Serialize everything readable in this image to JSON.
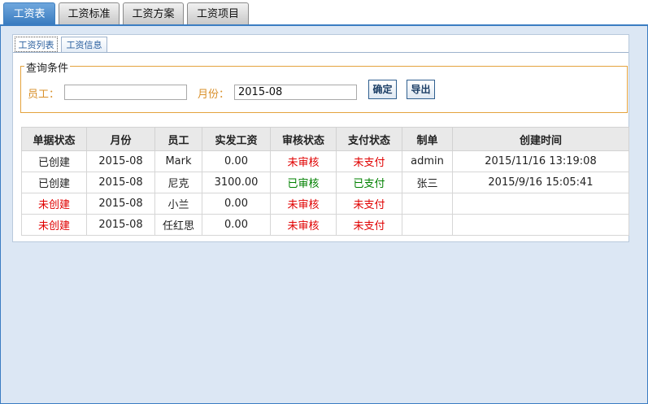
{
  "top_tabs": [
    "工资表",
    "工资标准",
    "工资方案",
    "工资项目"
  ],
  "sub_tabs": [
    "工资列表",
    "工资信息"
  ],
  "query": {
    "legend": "查询条件",
    "employee_label": "员工：",
    "employee_value": "",
    "month_label": "月份：",
    "month_value": "2015-08",
    "confirm_button": "确定",
    "export_button": "导出"
  },
  "table": {
    "columns": [
      "单据状态",
      "月份",
      "员工",
      "实发工资",
      "审核状态",
      "支付状态",
      "制单",
      "创建时间"
    ],
    "rows": [
      [
        "已创建",
        "2015-08",
        "Mark",
        "0.00",
        "未审核",
        "未支付",
        "admin",
        "2015/11/16 13:19:08"
      ],
      [
        "已创建",
        "2015-08",
        "尼克",
        "3100.00",
        "已审核",
        "已支付",
        "张三",
        "2015/9/16 15:05:41"
      ],
      [
        "未创建",
        "2015-08",
        "小兰",
        "0.00",
        "未审核",
        "未支付",
        "",
        ""
      ],
      [
        "未创建",
        "2015-08",
        "任红思",
        "0.00",
        "未审核",
        "未支付",
        "",
        ""
      ]
    ]
  },
  "colors": {
    "accent": "#3b7dc2",
    "panel_bg": "#dce7f4",
    "fieldset_border": "#e4a33d",
    "status_negative": "#e00000",
    "status_positive": "#008000"
  }
}
